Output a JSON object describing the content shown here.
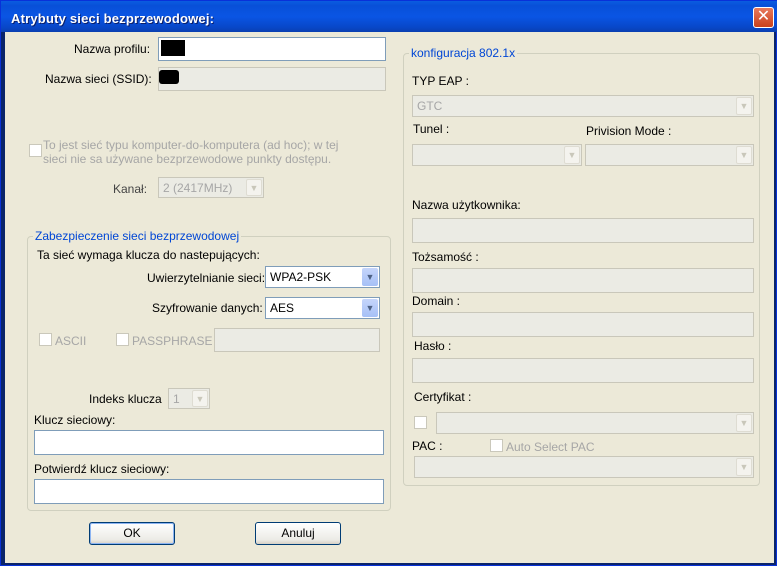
{
  "window": {
    "title": "Atrybuty sieci bezprzewodowej:",
    "close_glyph": "✕"
  },
  "profile": {
    "name_label": "Nazwa profilu:",
    "ssid_label": "Nazwa sieci (SSID):",
    "adhoc_label_1": "To jest sieć typu komputer-do-komputera (ad hoc); w tej",
    "adhoc_label_2": "sieci nie sa używane bezprzewodowe punkty dostępu.",
    "channel_label": "Kanał:",
    "channel_value": "2  (2417MHz)"
  },
  "security": {
    "group_title": "Zabezpieczenie sieci bezprzewodowej",
    "intro": "Ta sieć wymaga klucza do nastepujących:",
    "auth_label": "Uwierzytelnianie sieci:",
    "auth_value": "WPA2-PSK",
    "enc_label": "Szyfrowanie danych:",
    "enc_value": "AES",
    "ascii_label": "ASCII",
    "passphrase_label": "PASSPHRASE",
    "key_index_label": "Indeks klucza",
    "key_index_value": "1",
    "network_key_label": "Klucz sieciowy:",
    "confirm_key_label": "Potwierdź klucz sieciowy:"
  },
  "eap": {
    "group_title": "konfiguracja 802.1x",
    "type_label": "TYP EAP :",
    "type_value": "GTC",
    "tunnel_label": "Tunel :",
    "provision_label": "Privision Mode :",
    "username_label": "Nazwa użytkownika:",
    "identity_label": "Tożsamość :",
    "domain_label": "Domain :",
    "password_label": "Hasło :",
    "certificate_label": "Certyfikat :",
    "pac_label": "PAC :",
    "auto_pac_label": "Auto Select PAC"
  },
  "buttons": {
    "ok": "OK",
    "cancel": "Anuluj"
  },
  "icons": {
    "dropdown_arrow": "▼"
  },
  "colors": {
    "title_bar": "#0a55e4",
    "group_title": "#0046d5",
    "close_button": "#c9411c"
  }
}
